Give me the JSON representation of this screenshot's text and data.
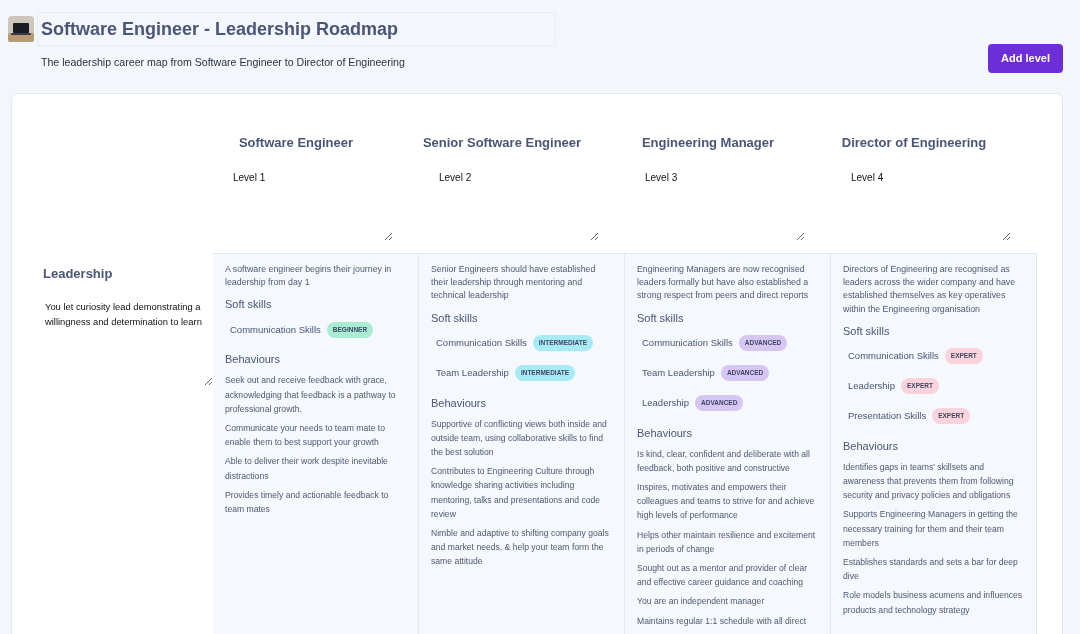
{
  "header": {
    "title": "Software Engineer - Leadership Roadmap",
    "subtitle": "The leadership career map from Software Engineer to Director of Engineering",
    "add_button": "Add level"
  },
  "levels": [
    {
      "title": "Software Engineer",
      "field_value": "Level 1"
    },
    {
      "title": "Senior Software Engineer",
      "field_value": "Level 2"
    },
    {
      "title": "Engineering Manager",
      "field_value": "Level 3"
    },
    {
      "title": "Director of Engineering",
      "field_value": "Level 4"
    }
  ],
  "rows": [
    {
      "title": "Leadership",
      "description": "You let curiosity lead demonstrating a willingness and determination to learn",
      "cells": [
        {
          "summary": "A software engineer begins their journey in leadership from day 1",
          "soft_skills_heading": "Soft skills",
          "soft_skills": [
            {
              "name": "Communication Skills",
              "proficiency": "BEGINNER",
              "color": "#aaedd3"
            }
          ],
          "behaviours_heading": "Behaviours",
          "behaviours": [
            "Seek out and receive feedback with grace, acknowledging that feedback is a pathway to professional growth.",
            "Communicate your needs to team mate to enable them to best support your growth",
            "Able to deliver their work despite inevitable distractions",
            "Provides timely and actionable feedback to team mates"
          ]
        },
        {
          "summary": "Senior Engineers should have established their leadership through mentoring and technical leadership",
          "soft_skills_heading": "Soft skills",
          "soft_skills": [
            {
              "name": "Communication Skills",
              "proficiency": "INTERMEDIATE",
              "color": "#a8ebf7"
            },
            {
              "name": "Team Leadership",
              "proficiency": "INTERMEDIATE",
              "color": "#a8ebf7"
            }
          ],
          "behaviours_heading": "Behaviours",
          "behaviours": [
            "Supportive of conflicting views both inside and outside team, using collaborative skills to find the best solution",
            "Contributes to Engineering Culture through knowledge sharing activities including mentoring, talks and presentations and code review",
            "Nimble and adaptive to shifting company goals and market needs, & help your team form the same attitude"
          ]
        },
        {
          "summary": "Engineering Managers are now recognised leaders formally but have also established a strong respect from peers and direct reports",
          "soft_skills_heading": "Soft skills",
          "soft_skills": [
            {
              "name": "Communication Skills",
              "proficiency": "ADVANCED",
              "color": "#d7c6f4"
            },
            {
              "name": "Team Leadership",
              "proficiency": "ADVANCED",
              "color": "#d7c6f4"
            },
            {
              "name": "Leadership",
              "proficiency": "ADVANCED",
              "color": "#d7c6f4"
            }
          ],
          "behaviours_heading": "Behaviours",
          "behaviours": [
            "Is kind, clear, confident and deliberate with all feedback, both positive and constructive",
            "Inspires, motivates and empowers their colleagues and teams to strive for and achieve high levels of performance",
            "Helps other maintain resilience and excitement in periods of change",
            "Sought out as a mentor and provider of clear and effective career guidance and coaching",
            "You are an independent manager",
            "Maintains regular 1:1 schedule with all direct"
          ]
        },
        {
          "summary": "Directors of Engineering are recognised as leaders across the wider company and have established themselves as key operatives within the Engineering organisation",
          "soft_skills_heading": "Soft skills",
          "soft_skills": [
            {
              "name": "Communication Skills",
              "proficiency": "EXPERT",
              "color": "#fbd3da"
            },
            {
              "name": "Leadership",
              "proficiency": "EXPERT",
              "color": "#fbd3da"
            },
            {
              "name": "Presentation Skills",
              "proficiency": "EXPERT",
              "color": "#fbd3da"
            }
          ],
          "behaviours_heading": "Behaviours",
          "behaviours": [
            "Identifies gaps in teams' skillsets and awareness that prevents them from following security and privacy policies and obligations",
            "Supports Engineering Managers in getting the necessary training for them and their team members",
            "Establishes standards and sets a bar for deep dive",
            "Role models business acumens and influences products and technology strategy"
          ]
        }
      ]
    }
  ]
}
